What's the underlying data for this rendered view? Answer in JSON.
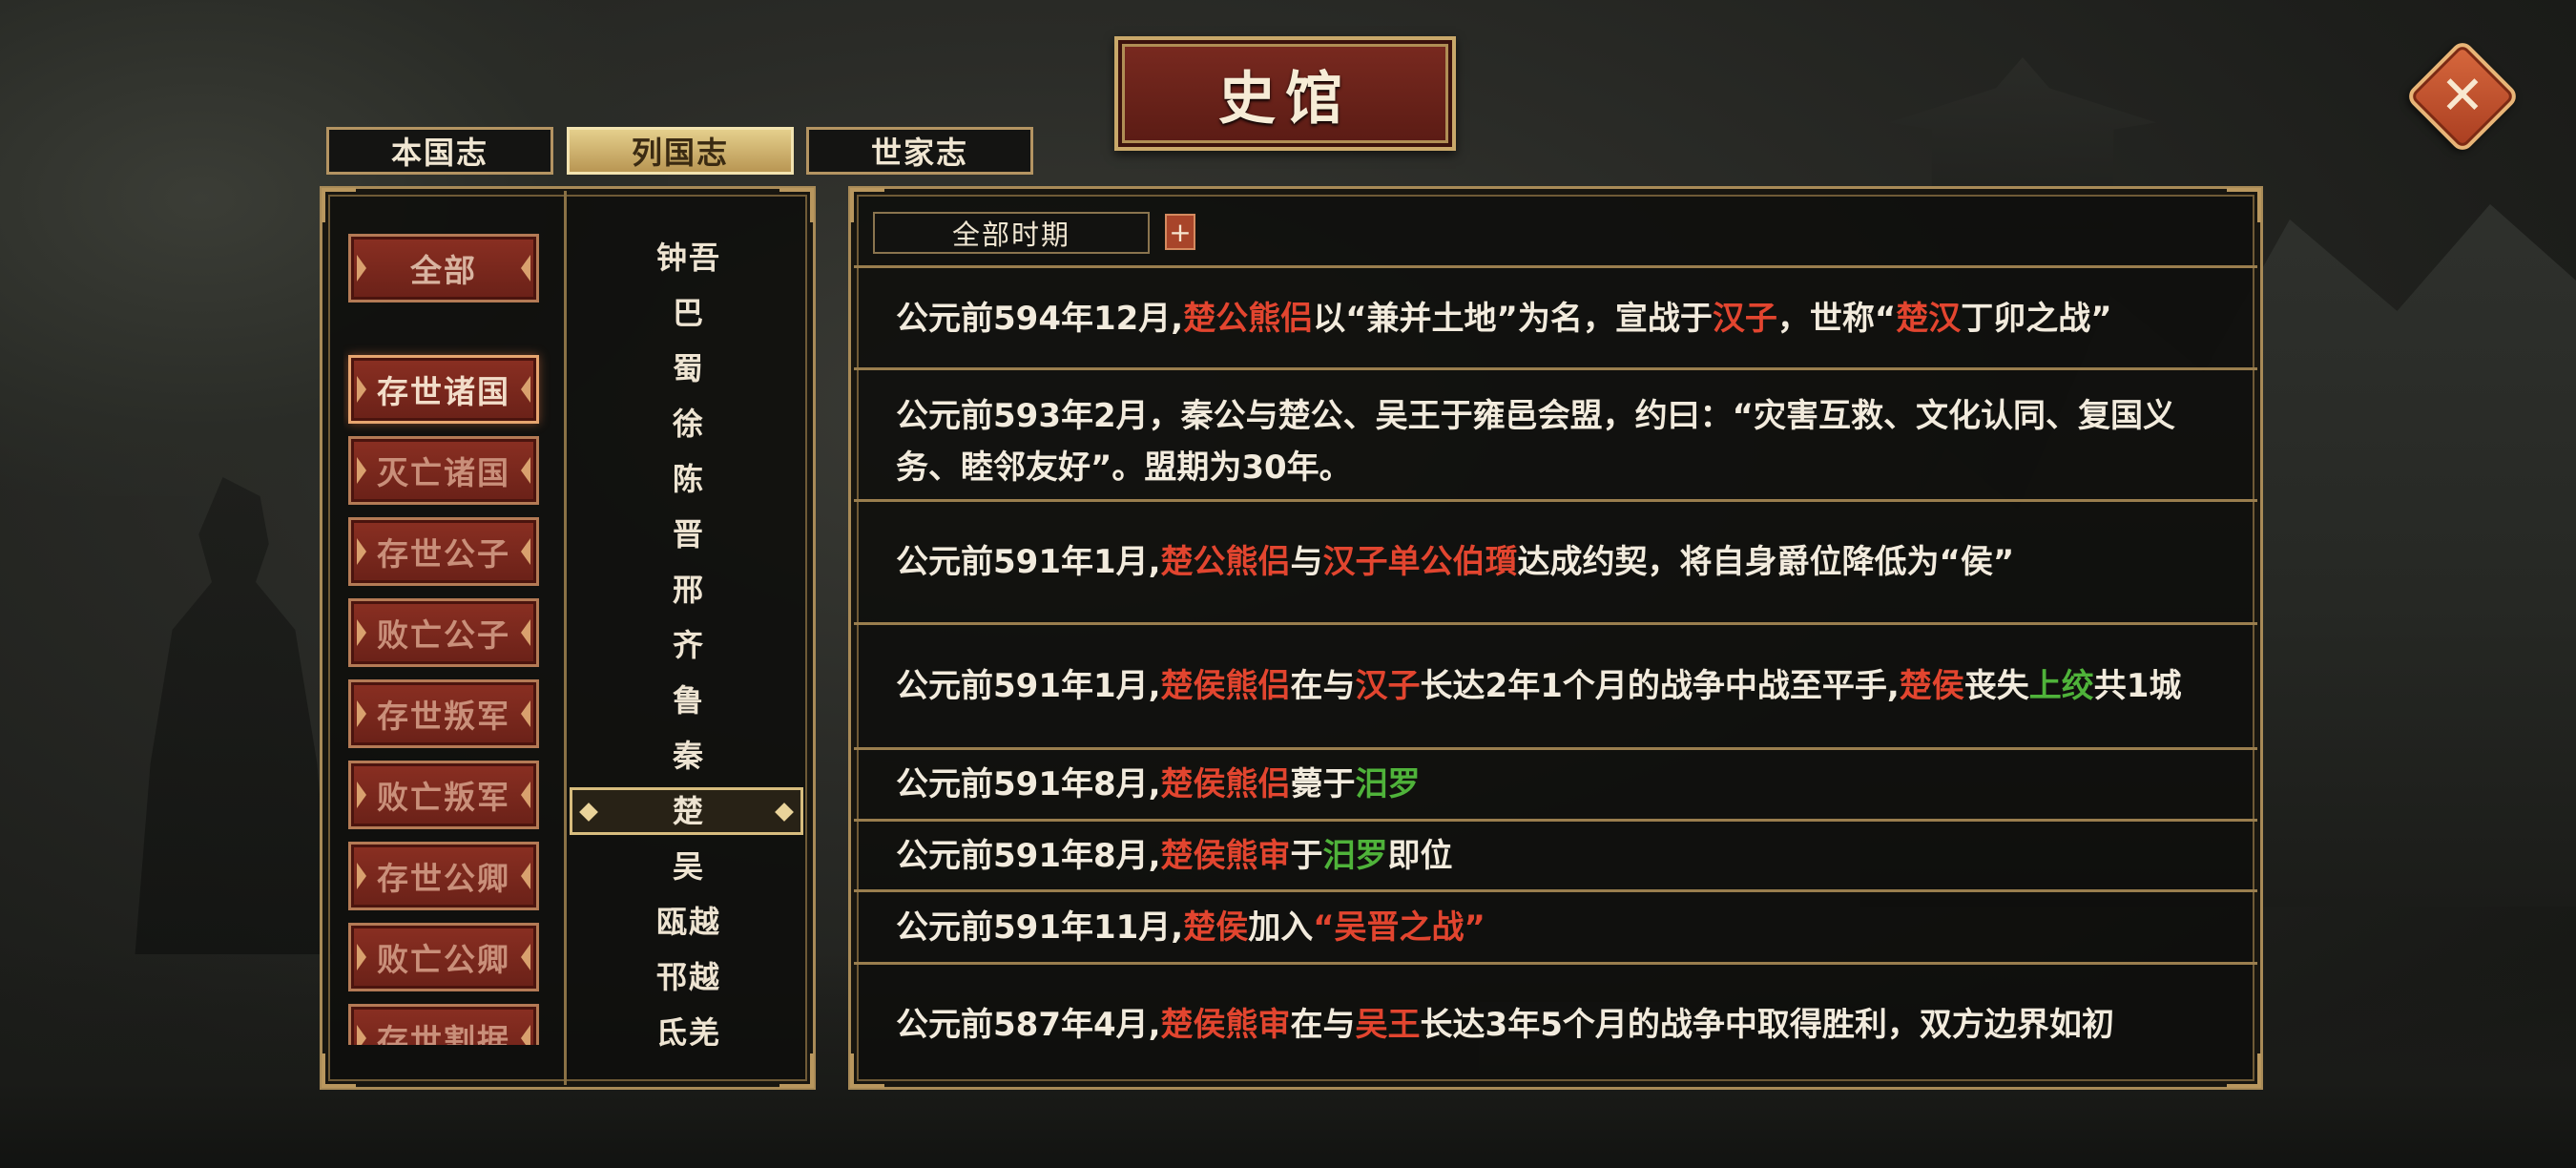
{
  "title": "史馆",
  "close_label": "✕",
  "tabs": [
    {
      "label": "本国志"
    },
    {
      "label": "列国志"
    },
    {
      "label": "世家志"
    }
  ],
  "categories": [
    {
      "label": "全部"
    },
    {
      "label": "存世诸国"
    },
    {
      "label": "灭亡诸国"
    },
    {
      "label": "存世公子"
    },
    {
      "label": "败亡公子"
    },
    {
      "label": "存世叛军"
    },
    {
      "label": "败亡叛军"
    },
    {
      "label": "存世公卿"
    },
    {
      "label": "败亡公卿"
    },
    {
      "label": "存世割据"
    }
  ],
  "states": [
    {
      "label": "钟吾"
    },
    {
      "label": "巴"
    },
    {
      "label": "蜀"
    },
    {
      "label": "徐"
    },
    {
      "label": "陈"
    },
    {
      "label": "晋"
    },
    {
      "label": "邢"
    },
    {
      "label": "齐"
    },
    {
      "label": "鲁"
    },
    {
      "label": "秦"
    },
    {
      "label": "楚"
    },
    {
      "label": "吴"
    },
    {
      "label": "瓯越"
    },
    {
      "label": "邗越"
    },
    {
      "label": "氐羌"
    }
  ],
  "period_filter": {
    "value": "全部时期",
    "plus": "+"
  },
  "entries": [
    {
      "segments": [
        {
          "t": "公元前594年12月,"
        },
        {
          "t": "楚公熊侣",
          "c": "red"
        },
        {
          "t": "以“兼并土地”为名，宣战于"
        },
        {
          "t": "汉子",
          "c": "red"
        },
        {
          "t": "，世称“"
        },
        {
          "t": "楚汉",
          "c": "red"
        },
        {
          "t": "丁卯之战”"
        }
      ]
    },
    {
      "segments": [
        {
          "t": "公元前593年2月，秦公与楚公、吴王于雍邑会盟，约曰：“灾害互救、文化认同、复国义务、睦邻友好”。盟期为30年。"
        }
      ]
    },
    {
      "segments": [
        {
          "t": "公元前591年1月,"
        },
        {
          "t": "楚公熊侣",
          "c": "red"
        },
        {
          "t": "与"
        },
        {
          "t": "汉子单公伯瓆",
          "c": "red"
        },
        {
          "t": "达成约契，将自身爵位降低为“侯”"
        }
      ]
    },
    {
      "segments": [
        {
          "t": "公元前591年1月,"
        },
        {
          "t": "楚侯熊侣",
          "c": "red"
        },
        {
          "t": "在与"
        },
        {
          "t": "汉子",
          "c": "red"
        },
        {
          "t": "长达2年1个月的战争中战至平手,"
        },
        {
          "t": "楚侯",
          "c": "red"
        },
        {
          "t": "丧失"
        },
        {
          "t": "上绞",
          "c": "green"
        },
        {
          "t": "共1城"
        }
      ]
    },
    {
      "segments": [
        {
          "t": "公元前591年8月,"
        },
        {
          "t": "楚侯熊侣",
          "c": "red"
        },
        {
          "t": "薨于"
        },
        {
          "t": "汨罗",
          "c": "green"
        }
      ]
    },
    {
      "segments": [
        {
          "t": "公元前591年8月,"
        },
        {
          "t": "楚侯熊审",
          "c": "red"
        },
        {
          "t": "于"
        },
        {
          "t": "汨罗",
          "c": "green"
        },
        {
          "t": "即位"
        }
      ]
    },
    {
      "segments": [
        {
          "t": "公元前591年11月,"
        },
        {
          "t": "楚侯",
          "c": "red"
        },
        {
          "t": "加入"
        },
        {
          "t": "“吴晋之战”",
          "c": "red"
        }
      ]
    },
    {
      "segments": [
        {
          "t": "公元前587年4月,"
        },
        {
          "t": "楚侯熊审",
          "c": "red"
        },
        {
          "t": "在与"
        },
        {
          "t": "吴王",
          "c": "red"
        },
        {
          "t": "长达3年5个月的战争中取得胜利，双方边界如初"
        }
      ]
    }
  ],
  "colors": {
    "accent_red": "#e2452f",
    "accent_green": "#4fb33a",
    "gold": "#b49462"
  }
}
